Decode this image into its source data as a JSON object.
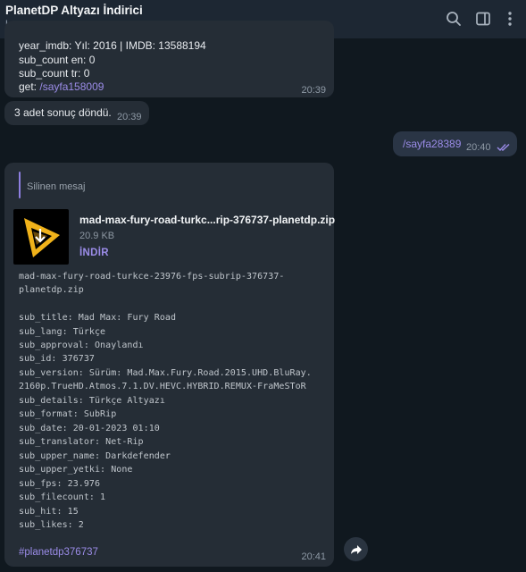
{
  "header": {
    "title": "PlanetDP Altyazı İndirici",
    "subtitle": "bot",
    "icons": [
      "search-icon",
      "sidebar-toggle-icon",
      "more-vertical-icon"
    ]
  },
  "messages": {
    "m1": {
      "lines": [
        "year_imdb: Yıl: 2016 | IMDB: 13588194",
        "sub_count en: 0",
        "sub_count tr: 0"
      ],
      "get_label": "get: ",
      "get_link": "/sayfa158009",
      "time": "20:39"
    },
    "m2": {
      "text": "3 adet sonuç döndü.",
      "time": "20:39"
    },
    "m3": {
      "text": "/sayfa28389",
      "time": "20:40",
      "status": "read-double-check-icon"
    },
    "m4": {
      "reply": "Silinen mesaj",
      "file": {
        "name": "mad-max-fury-road-turkc...rip-376737-planetdp.zip",
        "size": "20.9 KB",
        "download_label": "İNDİR"
      },
      "mono_lines": [
        "mad-max-fury-road-turkce-23976-fps-subrip-376737-",
        "planetdp.zip",
        "",
        "sub_title: Mad Max: Fury Road",
        "sub_lang: Türkçe",
        "sub_approval: Onaylandı",
        "sub_id: 376737",
        "sub_version: Sürüm: Mad.Max.Fury.Road.2015.UHD.BluRay.",
        "2160p.TrueHD.Atmos.7.1.DV.HEVC.HYBRID.REMUX-FraMeSToR",
        "sub_details: Türkçe Altyazı",
        "sub_format: SubRip",
        "sub_date: 20-01-2023 01:10",
        "sub_translator: Net-Rip",
        "sub_upper_name: Darkdefender",
        "sub_upper_yetki: None",
        "sub_fps: 23.976",
        "sub_filecount: 1",
        "sub_hit: 15",
        "sub_likes: 2"
      ],
      "hashtag": "#planetdp376737",
      "time": "20:41"
    }
  },
  "colors": {
    "accent": "#9b8ce8",
    "bubble": "#252d36",
    "background": "#10181f"
  }
}
